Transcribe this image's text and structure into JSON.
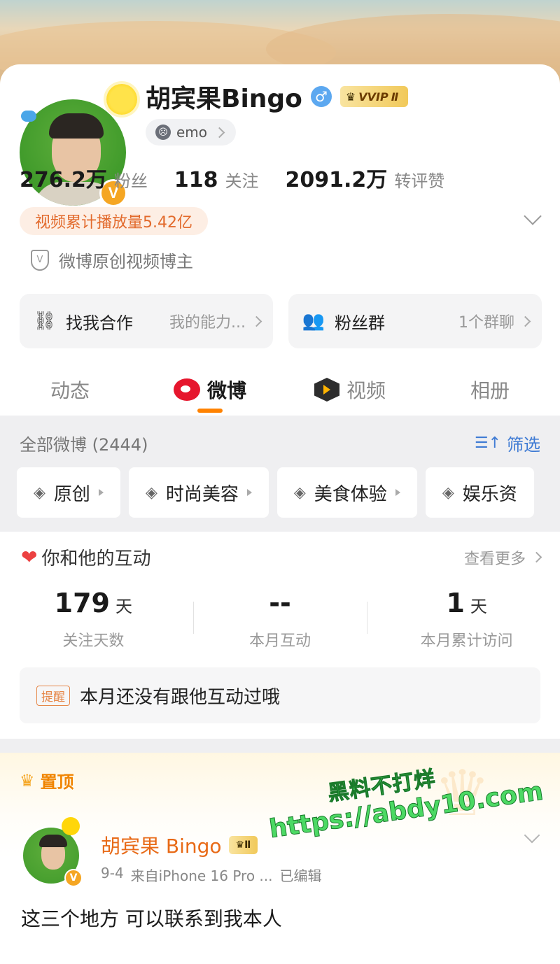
{
  "profile": {
    "name": "胡宾果Bingo",
    "gender_symbol": "♂",
    "vip_label": "VVIP",
    "vip_level": "Ⅱ",
    "verified_mark": "V",
    "mood_label": "emo",
    "stats": [
      {
        "value": "276.2万",
        "label": "粉丝"
      },
      {
        "value": "118",
        "label": "关注"
      },
      {
        "value": "2091.2万",
        "label": "转评赞"
      }
    ],
    "video_plays": "视频累计播放量5.42亿",
    "certification": "微博原创视频博主",
    "shield_symbol": "V",
    "accent_color": "#ff8200",
    "verified_color": "#f5a623"
  },
  "actions": [
    {
      "icon": "handshake-icon",
      "glyph": "⛓",
      "label": "找我合作",
      "right": "我的能力..."
    },
    {
      "icon": "fans-group-icon",
      "glyph": "👥",
      "label": "粉丝群",
      "right": "1个群聊"
    }
  ],
  "tabs": [
    {
      "label": "动态",
      "icon": ""
    },
    {
      "label": "微博",
      "icon": "weibo-logo-icon"
    },
    {
      "label": "视频",
      "icon": "video-icon"
    },
    {
      "label": "相册",
      "icon": ""
    }
  ],
  "active_tab": "微博",
  "feed": {
    "all_label": "全部微博 (2444)",
    "filter_label": "筛选",
    "filter_glyph": "☰↑",
    "chip_glyph": "◈",
    "chips": [
      "原创",
      "时尚美容",
      "美食体验",
      "娱乐资"
    ]
  },
  "interaction": {
    "title": "你和他的互动",
    "heart_glyph": "❤",
    "more_label": "查看更多",
    "stats": [
      {
        "value": "179",
        "unit": "天",
        "label": "关注天数"
      },
      {
        "value": "--",
        "unit": "",
        "label": "本月互动"
      },
      {
        "value": "1",
        "unit": "天",
        "label": "本月累计访问"
      }
    ],
    "reminder_tag": "提醒",
    "reminder_text": "本月还没有跟他互动过哦"
  },
  "pinned": {
    "label": "置顶",
    "crown_glyph": "♛",
    "author": "胡宾果 Bingo",
    "vip_level": "Ⅱ",
    "date": "9-4",
    "source": "来自iPhone 16 Pro ...",
    "edited": "已编辑",
    "text": "这三个地方 可以联系到我本人"
  },
  "watermark": {
    "line1": "黑料不打烊",
    "line2": "https://abdy10.com"
  }
}
